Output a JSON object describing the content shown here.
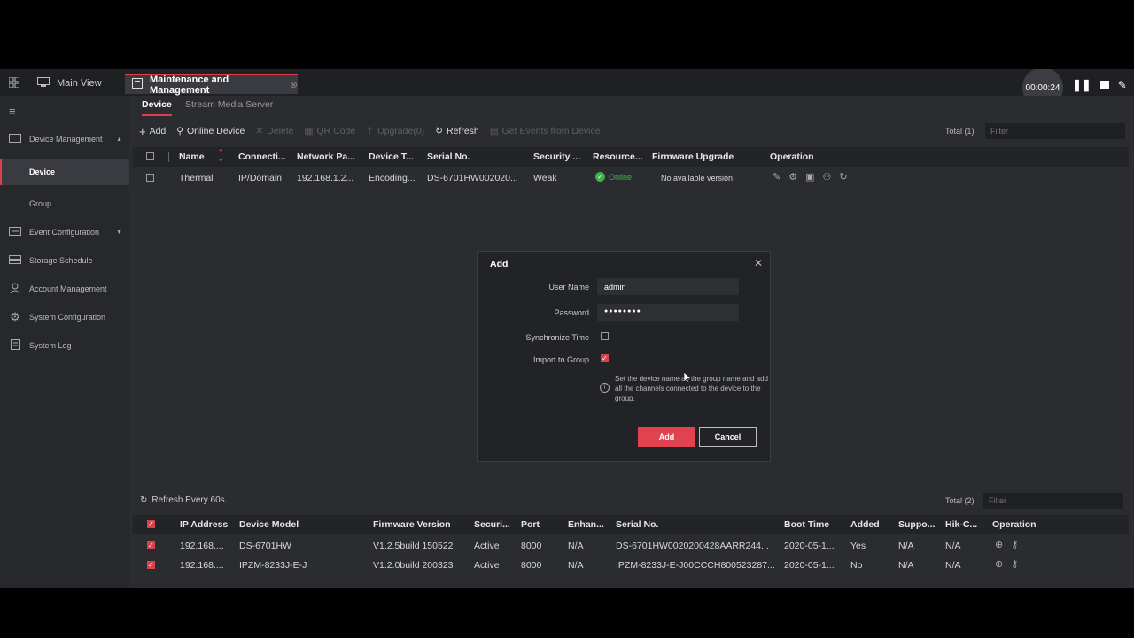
{
  "tabs": {
    "main_view": "Main View",
    "maintenance": "Maintenance and Management"
  },
  "recorder": {
    "time": "00:00:24"
  },
  "sidebar": {
    "items": [
      {
        "label": "Device Management",
        "icon": "device-management-icon"
      },
      {
        "label": "Device"
      },
      {
        "label": "Group"
      },
      {
        "label": "Event Configuration",
        "icon": "event-icon"
      },
      {
        "label": "Storage Schedule",
        "icon": "storage-icon"
      },
      {
        "label": "Account Management",
        "icon": "account-icon"
      },
      {
        "label": "System Configuration",
        "icon": "gear-icon"
      },
      {
        "label": "System Log",
        "icon": "log-icon"
      }
    ]
  },
  "subtabs": {
    "device": "Device",
    "stream": "Stream Media Server"
  },
  "toolbar": {
    "add": "Add",
    "online_device": "Online Device",
    "delete": "Delete",
    "qr_code": "QR Code",
    "upgrade": "Upgrade(0)",
    "refresh": "Refresh",
    "get_events": "Get Events from Device",
    "total": "Total (1)",
    "filter_placeholder": "Filter"
  },
  "device_table": {
    "headers": [
      "Name",
      "Connecti...",
      "Network Pa...",
      "Device T...",
      "Serial No.",
      "Security ...",
      "Resource...",
      "Firmware Upgrade",
      "Operation"
    ],
    "rows": [
      {
        "name": "Thermal",
        "connection": "IP/Domain",
        "network": "192.168.1.2...",
        "device_type": "Encoding...",
        "serial": "DS-6701HW002020...",
        "security": "Weak",
        "resource": "Online",
        "firmware": "No available version"
      }
    ]
  },
  "dialog": {
    "title": "Add",
    "user_name_label": "User Name",
    "user_name_value": "admin",
    "password_label": "Password",
    "password_value": "●●●●●●●●",
    "sync_time_label": "Synchronize Time",
    "import_group_label": "Import to Group",
    "info": "Set the device name as the group name and add all the channels connected to the device to the group.",
    "add_button": "Add",
    "cancel_button": "Cancel"
  },
  "online_panel": {
    "refresh": "Refresh Every 60s.",
    "total": "Total (2)",
    "filter_placeholder": "Filter",
    "headers": [
      "IP Address",
      "Device Model",
      "Firmware Version",
      "Securi...",
      "Port",
      "Enhan...",
      "Serial No.",
      "Boot Time",
      "Added",
      "Suppo...",
      "Hik-C...",
      "Operation"
    ],
    "rows": [
      {
        "ip": "192.168....",
        "model": "DS-6701HW",
        "firmware": "V1.2.5build 150522",
        "security": "Active",
        "port": "8000",
        "enhanced": "N/A",
        "serial": "DS-6701HW0020200428AARR244...",
        "boot": "2020-05-1...",
        "added": "Yes",
        "support": "N/A",
        "hik": "N/A"
      },
      {
        "ip": "192.168....",
        "model": "IPZM-8233J-E-J",
        "firmware": "V1.2.0build 200323",
        "security": "Active",
        "port": "8000",
        "enhanced": "N/A",
        "serial": "IPZM-8233J-E-J00CCCH800523287...",
        "boot": "2020-05-1...",
        "added": "No",
        "support": "N/A",
        "hik": "N/A"
      }
    ]
  },
  "colors": {
    "accent": "#d9414b",
    "online": "#3cb44b"
  }
}
